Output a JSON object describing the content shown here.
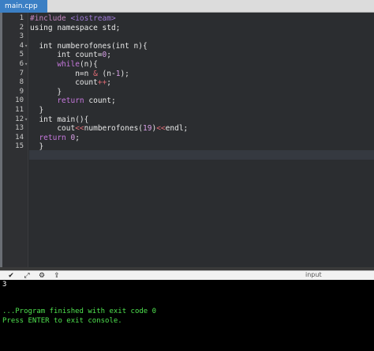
{
  "tab": {
    "label": "main.cpp"
  },
  "editor": {
    "line_numbers": [
      "1",
      "2",
      "3",
      "4",
      "5",
      "6",
      "7",
      "8",
      "9",
      "10",
      "11",
      "12",
      "13",
      "14",
      "15"
    ],
    "lines": [
      [
        {
          "t": "#include ",
          "c": "pp"
        },
        {
          "t": "<iostream>",
          "c": "str"
        }
      ],
      [
        {
          "t": "using namespace std;",
          "c": "kw"
        }
      ],
      [],
      [
        {
          "t": "  int numberofones(int n){",
          "c": "kw"
        }
      ],
      [
        {
          "t": "      int count=",
          "c": "kw"
        },
        {
          "t": "0",
          "c": "num"
        },
        {
          "t": ";",
          "c": "kw"
        }
      ],
      [
        {
          "t": "      ",
          "c": "kw"
        },
        {
          "t": "while",
          "c": "flow"
        },
        {
          "t": "(n){",
          "c": "kw"
        }
      ],
      [
        {
          "t": "          n=n ",
          "c": "kw"
        },
        {
          "t": "&",
          "c": "op"
        },
        {
          "t": " (n-",
          "c": "kw"
        },
        {
          "t": "1",
          "c": "num"
        },
        {
          "t": ");",
          "c": "kw"
        }
      ],
      [
        {
          "t": "          count",
          "c": "kw"
        },
        {
          "t": "++",
          "c": "op"
        },
        {
          "t": ";",
          "c": "kw"
        }
      ],
      [
        {
          "t": "      }",
          "c": "kw"
        }
      ],
      [
        {
          "t": "      ",
          "c": "kw"
        },
        {
          "t": "return",
          "c": "flow"
        },
        {
          "t": " count;",
          "c": "kw"
        }
      ],
      [
        {
          "t": "  }",
          "c": "kw"
        }
      ],
      [
        {
          "t": "  int main(){",
          "c": "kw"
        }
      ],
      [
        {
          "t": "      cout",
          "c": "kw"
        },
        {
          "t": "<<",
          "c": "op"
        },
        {
          "t": "numberofones(",
          "c": "kw"
        },
        {
          "t": "19",
          "c": "num"
        },
        {
          "t": ")",
          "c": "kw"
        },
        {
          "t": "<<",
          "c": "op"
        },
        {
          "t": "endl;",
          "c": "kw"
        }
      ],
      [
        {
          "t": "  ",
          "c": "kw"
        },
        {
          "t": "return",
          "c": "flow"
        },
        {
          "t": " ",
          "c": "kw"
        },
        {
          "t": "0",
          "c": "num"
        },
        {
          "t": ";",
          "c": "kw"
        }
      ],
      [
        {
          "t": "  }",
          "c": "kw"
        }
      ]
    ],
    "fold_markers": {
      "4": "▾",
      "6": "▾",
      "12": "▾"
    }
  },
  "toolbar": {
    "icons": [
      "chevron-down-icon",
      "expand-icon",
      "gear-icon",
      "share-icon"
    ],
    "glyphs": [
      "✔",
      "⤢",
      "⚙",
      "⇪"
    ],
    "input_label": "input"
  },
  "console": {
    "output": "3",
    "finished": "...Program finished with exit code 0",
    "prompt": "Press ENTER to exit console."
  },
  "colors": {
    "tab_active": "#3b7fc4",
    "editor_bg": "#2b2d30",
    "console_bg": "#000000",
    "console_text": "#4fe34f"
  }
}
